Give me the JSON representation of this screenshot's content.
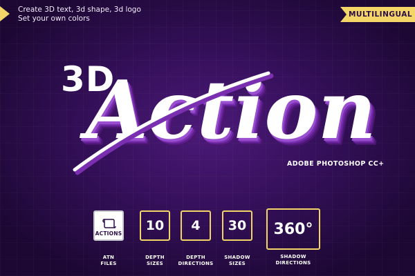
{
  "tagline": {
    "line1": "Create 3D text, 3d shape, 3d logo",
    "line2": "Set your own colors"
  },
  "badge": "MULTILINGUAL",
  "title": {
    "prefix": "3D",
    "script": "Action",
    "subtitle": "ADOBE PHOTOSHOP CC+"
  },
  "colors": {
    "accent": "#f3d568",
    "background": "#2a0d46",
    "extrusion": "#7a2fb0",
    "text": "#ffffff"
  },
  "features": [
    {
      "value": "ACTIONS",
      "icon": "script-scroll-icon",
      "caption": "ATN\nFILES"
    },
    {
      "value": "10",
      "caption": "DEPTH\nSIZES"
    },
    {
      "value": "4",
      "caption": "DEPTH\nDIRECTIONS"
    },
    {
      "value": "30",
      "caption": "SHADOW\nSIZES"
    },
    {
      "value": "360°",
      "caption": "SHADOW\nDIRECTIONS"
    }
  ]
}
